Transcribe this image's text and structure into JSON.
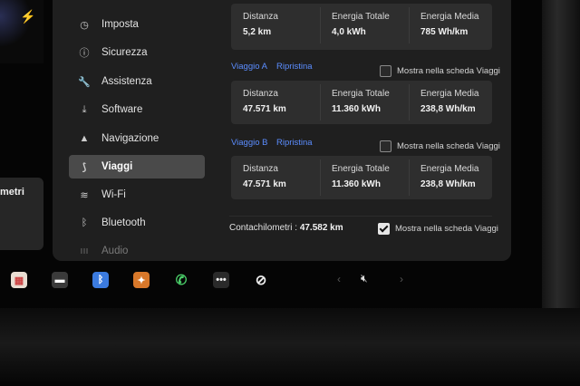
{
  "left_panel": {
    "card_text": "metri"
  },
  "sidebar": {
    "items": [
      {
        "label": "Imposta",
        "icon": "clock-icon"
      },
      {
        "label": "Sicurezza",
        "icon": "alert-circle-icon"
      },
      {
        "label": "Assistenza",
        "icon": "wrench-icon"
      },
      {
        "label": "Software",
        "icon": "download-icon"
      },
      {
        "label": "Navigazione",
        "icon": "navigation-arrow-icon"
      },
      {
        "label": "Viaggi",
        "icon": "trip-road-icon",
        "active": true
      },
      {
        "label": "Wi-Fi",
        "icon": "wifi-icon"
      },
      {
        "label": "Bluetooth",
        "icon": "bluetooth-icon"
      },
      {
        "label": "Audio",
        "icon": "equalizer-icon"
      }
    ]
  },
  "last_trip": {
    "distance_label": "Distanza",
    "distance": "5,2 km",
    "energy_label": "Energia Totale",
    "energy": "4,0 kWh",
    "avg_label": "Energia Media",
    "avg": "785 Wh/km"
  },
  "trip_a": {
    "name": "Viaggio A",
    "reset": "Ripristina",
    "show_label": "Mostra nella scheda Viaggi",
    "show_checked": false,
    "distance_label": "Distanza",
    "distance": "47.571 km",
    "energy_label": "Energia Totale",
    "energy": "11.360 kWh",
    "avg_label": "Energia Media",
    "avg": "238,8 Wh/km"
  },
  "trip_b": {
    "name": "Viaggio B",
    "reset": "Ripristina",
    "show_label": "Mostra nella scheda Viaggi",
    "show_checked": false,
    "distance_label": "Distanza",
    "distance": "47.571 km",
    "energy_label": "Energia Totale",
    "energy": "11.360 kWh",
    "avg_label": "Energia Media",
    "avg": "238,8 Wh/km"
  },
  "odometer": {
    "label": "Contachilometri :",
    "value": "47.582 km",
    "show_label": "Mostra nella scheda Viaggi",
    "show_checked": true
  },
  "dock": {
    "icons": [
      "calendar-icon",
      "dashcam-icon",
      "bluetooth-app-icon",
      "toybox-icon",
      "phone-icon",
      "more-icon",
      "no-signal-icon"
    ],
    "volume_icon": "volume-mute-icon"
  },
  "colors": {
    "accent": "#5b8dff",
    "panel": "#1f1f1f",
    "card": "#2e2e2e",
    "active": "#4a4a4a"
  }
}
